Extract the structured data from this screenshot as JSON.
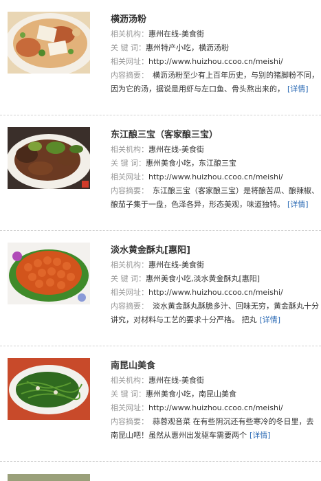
{
  "labels": {
    "org": "相关机构：",
    "keywords": "关 键 词：",
    "url": "相关网址：",
    "summary": "内容摘要：",
    "more": "[详情]"
  },
  "items": [
    {
      "title": "横沥汤粉",
      "org": "惠州在线-美食街",
      "keywords": "惠州特产小吃，横沥汤粉",
      "url": "http://www.huizhou.ccoo.cn/meishi/",
      "summary": "横沥汤粉至少有上百年历史，与别的猪脚粉不同，因为它的汤，据说是用虾与左口鱼、骨头熬出来的，"
    },
    {
      "title": "东江酿三宝（客家酿三宝）",
      "org": "惠州在线-美食街",
      "keywords": "惠州美食小吃，东江酿三宝",
      "url": "http://www.huizhou.ccoo.cn/meishi/",
      "summary": "东江酿三宝（客家酿三宝）是将酿苦瓜、酿辣椒、酿茄子集于一盘，色泽各异，形态美观，味道独特。"
    },
    {
      "title": "淡水黄金酥丸[惠阳]",
      "org": "惠州在线-美食街",
      "keywords": "惠州美食小吃,淡水黄金酥丸[惠阳]",
      "url": "http://www.huizhou.ccoo.cn/meishi/",
      "summary": "淡水黄金酥丸酥脆多汁、回味无穷，黄金酥丸十分讲究，对材料与工艺的要求十分严格。 把丸"
    },
    {
      "title": "南昆山美食",
      "org": "惠州在线-美食街",
      "keywords": "惠州美食小吃，南昆山美食",
      "url": "http://www.huizhou.ccoo.cn/meishi/",
      "summary": "蒜蓉观音菜 在有些阴沉还有些寒冷的冬日里，去南昆山吧！虽然从惠州出发驱车需要两个"
    }
  ]
}
